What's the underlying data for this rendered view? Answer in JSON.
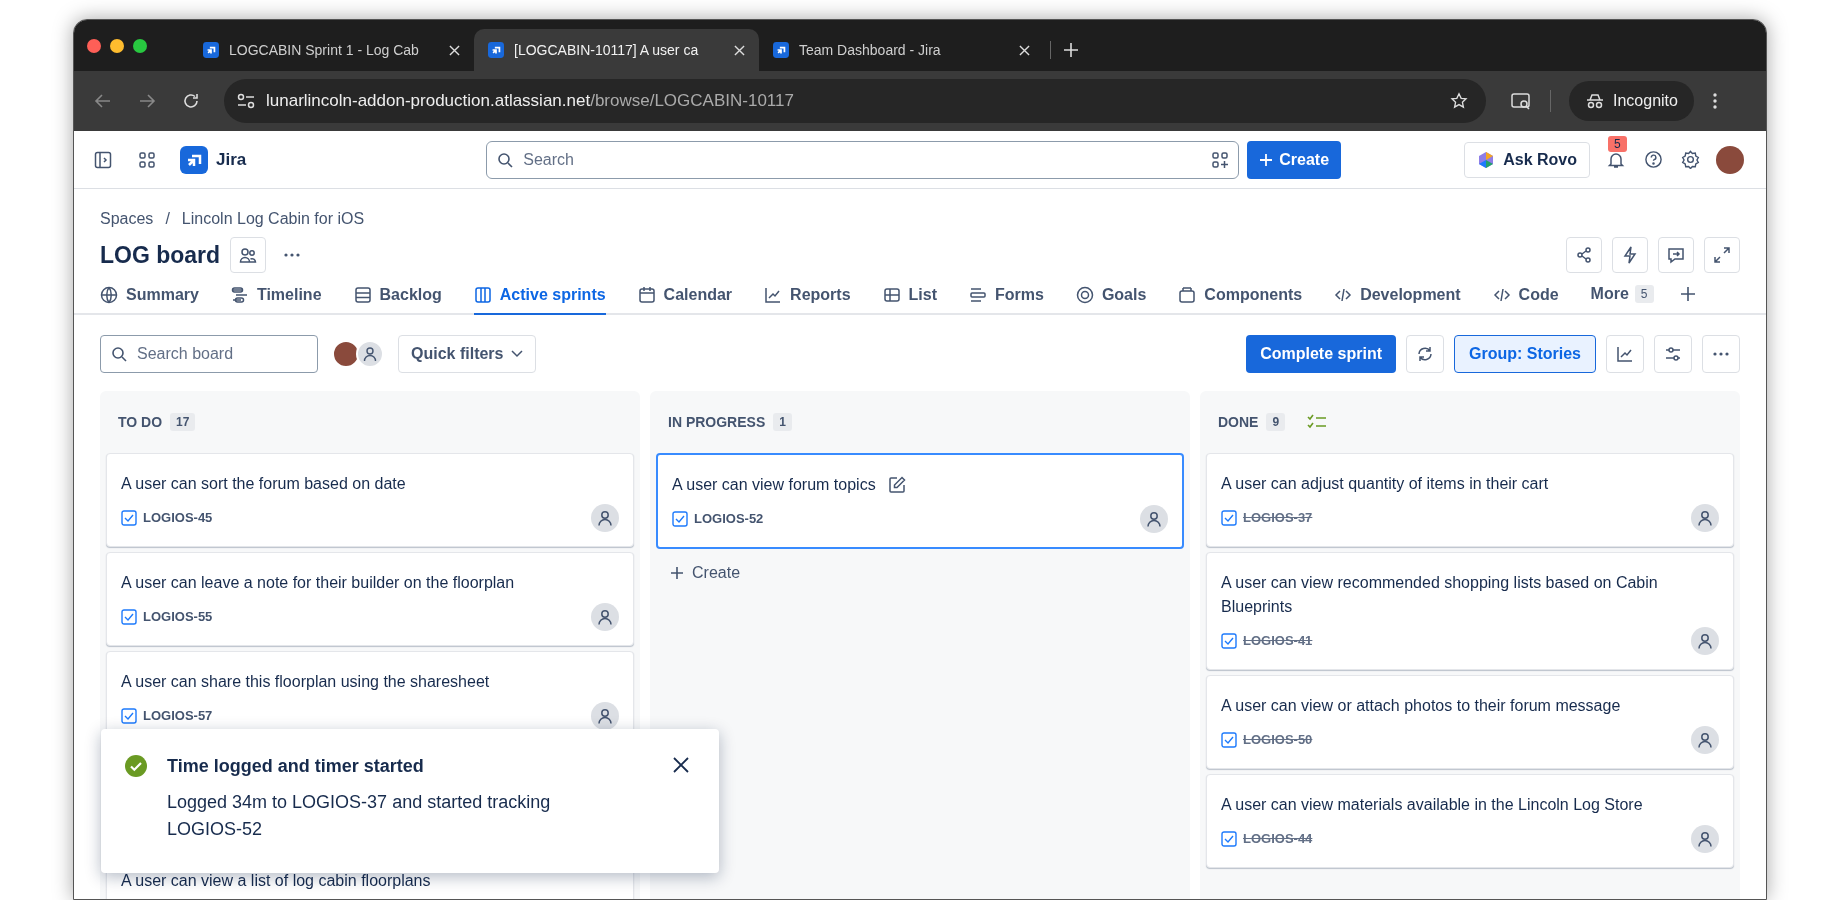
{
  "browser": {
    "tabs": [
      {
        "title": "LOGCABIN Sprint 1 - Log Cab",
        "selected": false
      },
      {
        "title": "[LOGCABIN-10117] A user ca",
        "selected": true
      },
      {
        "title": "Team Dashboard - Jira",
        "selected": false
      }
    ],
    "url": {
      "host": "lunarlincoln-addon-production.atlassian.net",
      "path": "/browse/LOGCABIN-10117"
    },
    "profile": "Incognito"
  },
  "header": {
    "app_name": "Jira",
    "search": {
      "placeholder": "Search"
    },
    "create_button": "Create",
    "ask_button": "Ask Rovo",
    "notification_count": "5"
  },
  "breadcrumb": {
    "items": [
      "Spaces",
      "Lincoln Log Cabin for iOS"
    ],
    "separator": "/"
  },
  "board": {
    "title": "LOG board"
  },
  "nav_tabs": [
    {
      "label": "Summary",
      "kind": "globe",
      "selected": false
    },
    {
      "label": "Timeline",
      "kind": "timeline",
      "selected": false
    },
    {
      "label": "Backlog",
      "kind": "backlog",
      "selected": false
    },
    {
      "label": "Active sprints",
      "kind": "board",
      "selected": true
    },
    {
      "label": "Calendar",
      "kind": "calendar",
      "selected": false
    },
    {
      "label": "Reports",
      "kind": "chart",
      "selected": false
    },
    {
      "label": "List",
      "kind": "list",
      "selected": false
    },
    {
      "label": "Forms",
      "kind": "forms",
      "selected": false
    },
    {
      "label": "Goals",
      "kind": "goal",
      "selected": false
    },
    {
      "label": "Components",
      "kind": "component",
      "selected": false
    },
    {
      "label": "Development",
      "kind": "code",
      "selected": false
    },
    {
      "label": "Code",
      "kind": "code",
      "selected": false
    }
  ],
  "more_tab": {
    "label": "More",
    "count": "5"
  },
  "toolbar": {
    "search": {
      "placeholder": "Search board"
    },
    "quick_filters": "Quick filters",
    "complete_button": "Complete sprint",
    "group_button": "Group: Stories"
  },
  "columns": [
    {
      "title": "TO DO",
      "count": "17",
      "done_icon": false,
      "cards": [
        {
          "title": "A user can sort the forum based on date",
          "key": "LOGIOS-45",
          "done": false,
          "selected": false
        },
        {
          "title": "A user can leave a note for their builder on the floorplan",
          "key": "LOGIOS-55",
          "done": false,
          "selected": false
        },
        {
          "title": "A user can share this floorplan using the sharesheet",
          "key": "LOGIOS-57",
          "done": false,
          "selected": false
        },
        {
          "title": "A user can view a list of log cabin floorplans",
          "selected": false
        }
      ]
    },
    {
      "title": "IN PROGRESS",
      "count": "1",
      "done_icon": false,
      "create": "Create",
      "cards": [
        {
          "title": "A user can view forum topics",
          "key": "LOGIOS-52",
          "done": false,
          "selected": true
        }
      ]
    },
    {
      "title": "DONE",
      "count": "9",
      "done_icon": true,
      "cards": [
        {
          "title": "A user can adjust quantity of items in their cart",
          "key": "LOGIOS-37",
          "done": true,
          "selected": false
        },
        {
          "title": "A user can view recommended shopping lists based on Cabin Blueprints",
          "key": "LOGIOS-41",
          "done": true,
          "selected": false
        },
        {
          "title": "A user can view or attach photos to their forum message",
          "key": "LOGIOS-50",
          "done": true,
          "selected": false
        },
        {
          "title": "A user can view materials available in the Lincoln Log Store",
          "key": "LOGIOS-44",
          "done": true,
          "selected": false
        }
      ]
    }
  ],
  "toast": {
    "title": "Time logged and timer started",
    "message": "Logged 34m to LOGIOS-37 and started tracking LOGIOS-52"
  }
}
